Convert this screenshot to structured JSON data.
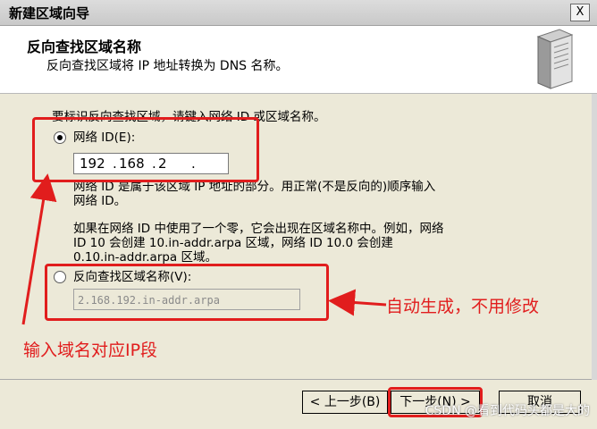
{
  "window": {
    "title": "新建区域向导",
    "close_glyph": "X"
  },
  "header": {
    "title": "反向查找区域名称",
    "subtitle": "反向查找区域将 IP 地址转换为 DNS 名称。"
  },
  "main": {
    "prompt": "要标识反向查找区域，请键入网络 ID 或区域名称。",
    "network_id_option": {
      "label": "网络 ID(E):",
      "selected": true
    },
    "ip": {
      "seg1": "192",
      "seg2": "168",
      "seg3": "2",
      "seg4": ""
    },
    "desc1_line1": "网络 ID 是属于该区域 IP 地址的部分。用正常(不是反向的)顺序输入",
    "desc1_line2": "网络 ID。",
    "desc2_line1": "如果在网络 ID 中使用了一个零，它会出现在区域名称中。例如，网络",
    "desc2_line2": "ID 10 会创建 10.in-addr.arpa 区域，网络 ID 10.0 会创建",
    "desc2_line3": "0.10.in-addr.arpa 区域。",
    "zone_name_option": {
      "label": "反向查找区域名称(V):",
      "selected": false
    },
    "zone_name_value": "2.168.192.in-addr.arpa"
  },
  "annotations": {
    "auto_generated": "自动生成，不用修改",
    "enter_ip": "输入域名对应IP段",
    "color": "#e11d1d"
  },
  "footer": {
    "back_label": "< 上一步(B)",
    "next_label": "下一步(N) >",
    "cancel_label": "取消",
    "watermark": "CSDN @看到代码头都是大的"
  }
}
